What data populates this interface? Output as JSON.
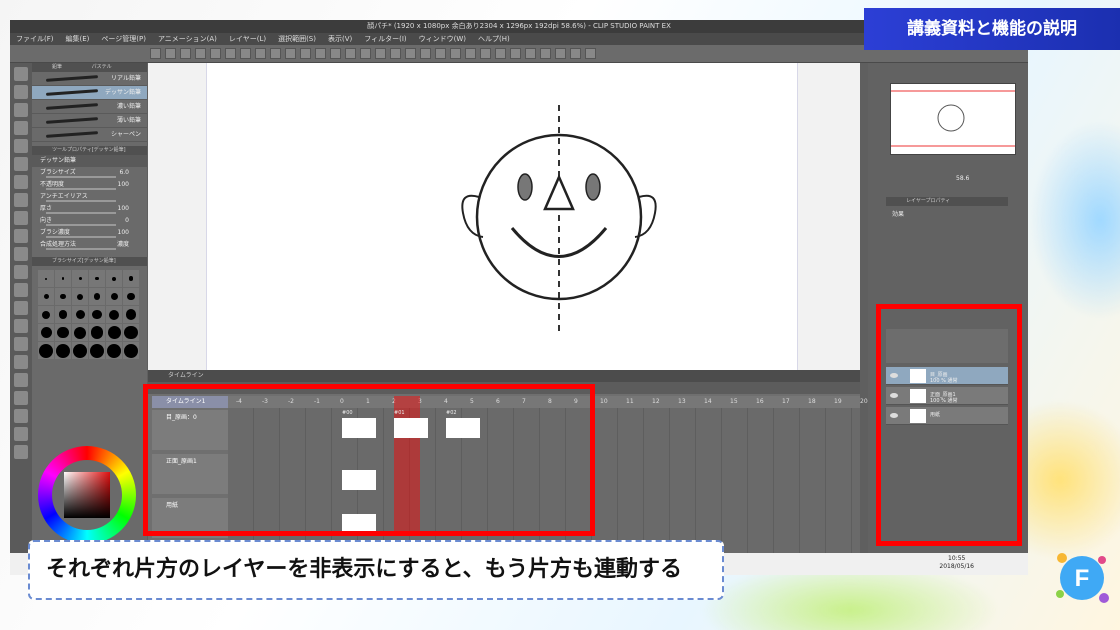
{
  "app": {
    "title": "顔パチ* (1920 x 1080px 余白あり2304 x 1296px 192dpi 58.6%) - CLIP STUDIO PAINT EX",
    "menu": [
      "ファイル(F)",
      "編集(E)",
      "ページ管理(P)",
      "アニメーション(A)",
      "レイヤー(L)",
      "選択範囲(S)",
      "表示(V)",
      "フィルター(I)",
      "ウィンドウ(W)",
      "ヘルプ(H)"
    ]
  },
  "subtool": {
    "tabs": [
      "鉛筆",
      "パステル"
    ],
    "brushes": [
      "リアル鉛筆",
      "デッサン鉛筆",
      "濃い鉛筆",
      "薄い鉛筆",
      "シャーペン"
    ],
    "selected_brush_index": 1,
    "props_header": "ツールプロパティ[デッサン鉛筆]",
    "selected_name": "デッサン鉛筆",
    "props": [
      {
        "label": "ブラシサイズ",
        "value": "6.0"
      },
      {
        "label": "不透明度",
        "value": "100"
      },
      {
        "label": "アンチエイリアス",
        "value": ""
      },
      {
        "label": "厚さ",
        "value": "100"
      },
      {
        "label": "向き",
        "value": "0"
      },
      {
        "label": "ブラシ濃度",
        "value": "100"
      },
      {
        "label": "合成処理方法",
        "value": "濃度"
      }
    ],
    "brushsize_header": "ブラシサイズ[デッサン鉛筆]",
    "sizes": [
      "0.7",
      "1",
      "1.5",
      "2",
      "2.5",
      "3",
      "4",
      "5",
      "6",
      "7",
      "8",
      "10",
      "12",
      "15",
      "17",
      "20",
      "25",
      "30",
      "40",
      "50",
      "60",
      "70",
      "80",
      "100",
      "120",
      "150",
      "170",
      "200",
      "250",
      "300",
      "400",
      "500",
      "600",
      "700",
      "800",
      "1000"
    ]
  },
  "timeline": {
    "tab": "タイムライン",
    "name": "タイムライン1",
    "frames": [
      "-4",
      "-3",
      "-2",
      "-1",
      "0",
      "1",
      "2",
      "3",
      "4",
      "5",
      "6",
      "7",
      "8",
      "9",
      "10",
      "11",
      "12",
      "13",
      "14",
      "15",
      "16",
      "17",
      "18",
      "19",
      "20"
    ],
    "tracks": [
      {
        "name": "目_原画：0",
        "cels": [
          "#00",
          "#01",
          "#02"
        ]
      },
      {
        "name": "正面_原画1",
        "cels": []
      },
      {
        "name": "用紙",
        "cels": []
      }
    ]
  },
  "layers": {
    "header": "レイヤープロパティ",
    "effect_label": "効果",
    "rows": [
      {
        "name": "目_原画",
        "sub": "100 % 通常"
      },
      {
        "name": "正面_原画1",
        "sub": "100 % 通常"
      },
      {
        "name": "用紙",
        "sub": ""
      }
    ]
  },
  "navigator": {
    "zoom": "58.6"
  },
  "taskbar": {
    "time": "10:55",
    "date": "2018/05/16"
  },
  "overlay": {
    "banner": "講義資料と機能の説明",
    "caption": "それぞれ片方のレイヤーを非表示にすると、もう片方も連動する"
  },
  "colors": {
    "highlight_red": "#ff0000",
    "banner_blue": "#2c3fd6",
    "caption_border": "#6a8bd1"
  }
}
